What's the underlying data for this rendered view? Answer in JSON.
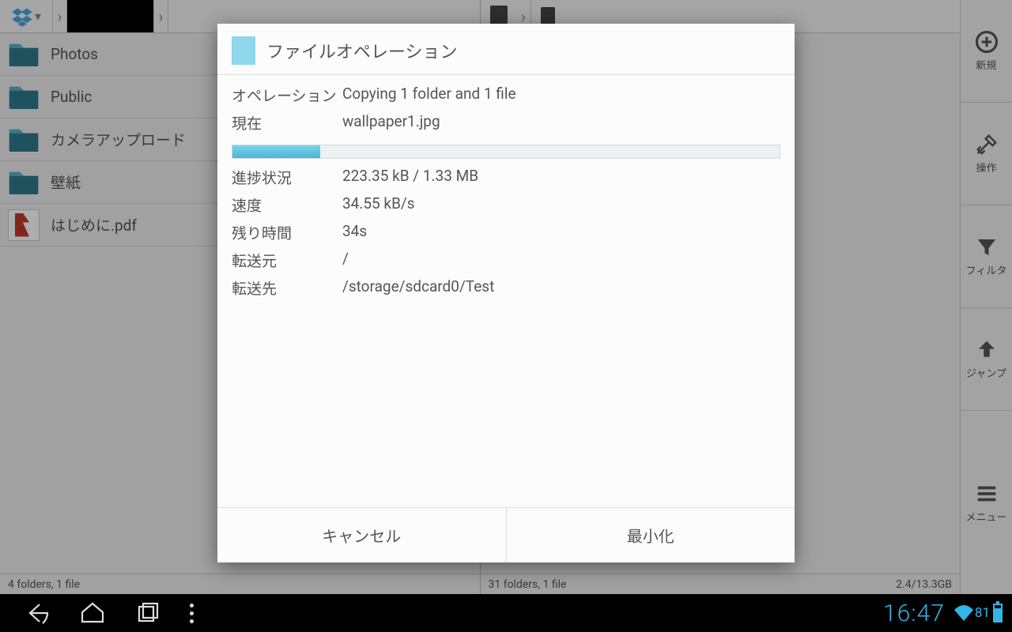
{
  "left_pane": {
    "status": "4 folders, 1 file",
    "items": [
      {
        "label": "Photos",
        "type": "folder"
      },
      {
        "label": "Public",
        "type": "folder"
      },
      {
        "label": "カメラアップロード",
        "type": "folder"
      },
      {
        "label": "壁紙",
        "type": "folder"
      },
      {
        "label": "はじめに.pdf",
        "type": "pdf"
      }
    ]
  },
  "right_pane": {
    "status": "31 folders, 1 file",
    "storage": "2.4/13.3GB"
  },
  "side_tools": [
    {
      "id": "new",
      "label": "新規"
    },
    {
      "id": "ops",
      "label": "操作"
    },
    {
      "id": "filter",
      "label": "フィルタ"
    },
    {
      "id": "jump",
      "label": "ジャンプ"
    },
    {
      "id": "menu",
      "label": "メニュー"
    }
  ],
  "dialog": {
    "title": "ファイルオペレーション",
    "rows": {
      "operation_k": "オペレーション",
      "operation_v": "Copying 1 folder and 1 file",
      "current_k": "現在",
      "current_v": "wallpaper1.jpg",
      "progress_k": "進捗状況",
      "progress_v": "223.35 kB / 1.33 MB",
      "speed_k": "速度",
      "speed_v": "34.55 kB/s",
      "remain_k": "残り時間",
      "remain_v": "34s",
      "src_k": "転送元",
      "src_v": "/",
      "dst_k": "転送先",
      "dst_v": "/storage/sdcard0/Test"
    },
    "progress_percent": 16,
    "cancel": "キャンセル",
    "minimize": "最小化"
  },
  "system": {
    "clock": "16:47",
    "battery": "81"
  }
}
